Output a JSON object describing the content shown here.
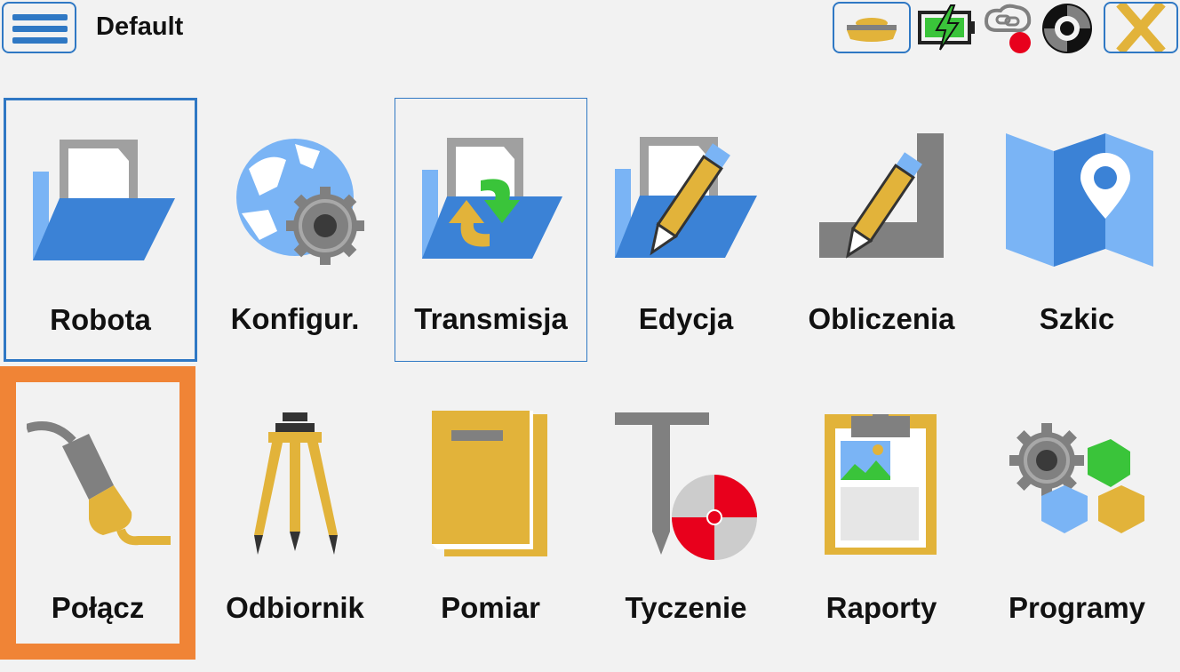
{
  "header": {
    "title": "Default"
  },
  "colors": {
    "accent": "#2f78c4",
    "highlight": "#f08436",
    "yellow": "#e2b33a",
    "gray": "#808080",
    "blue": "#3b82d6",
    "lightblue": "#7ab4f5"
  },
  "toolbar": {
    "icons": [
      "menu-icon",
      "rover-receiver-icon",
      "battery-charging-icon",
      "link-disconnected-icon",
      "sync-icon",
      "close-icon"
    ]
  },
  "tiles": [
    {
      "label": "Robota",
      "icon": "folder-icon"
    },
    {
      "label": "Konfigur.",
      "icon": "globe-gear-icon"
    },
    {
      "label": "Transmisja",
      "icon": "folder-transfer-icon"
    },
    {
      "label": "Edycja",
      "icon": "folder-edit-icon"
    },
    {
      "label": "Obliczenia",
      "icon": "calculation-icon"
    },
    {
      "label": "Szkic",
      "icon": "map-icon"
    },
    {
      "label": "Połącz",
      "icon": "plug-icon"
    },
    {
      "label": "Odbiornik",
      "icon": "tripod-icon"
    },
    {
      "label": "Pomiar",
      "icon": "book-icon"
    },
    {
      "label": "Tyczenie",
      "icon": "stakeout-icon"
    },
    {
      "label": "Raporty",
      "icon": "report-icon"
    },
    {
      "label": "Programy",
      "icon": "programs-icon"
    }
  ]
}
